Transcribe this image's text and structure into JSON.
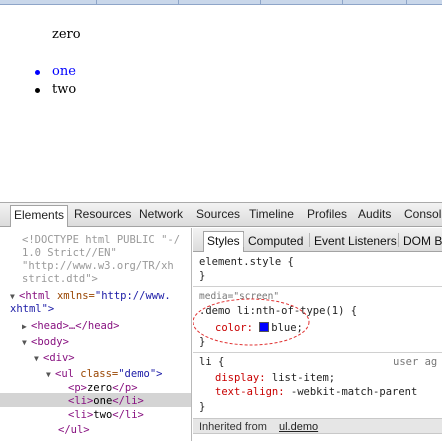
{
  "rendered_page": {
    "paragraph": "zero",
    "list_items": [
      "one",
      "two"
    ],
    "bullet_color": "#0000ff"
  },
  "devtools": {
    "tabs": [
      "Elements",
      "Resources",
      "Network",
      "Sources",
      "Timeline",
      "Profiles",
      "Audits",
      "Consol"
    ],
    "active_tab": "Elements",
    "dom": {
      "doctype_1": "<!DOCTYPE html PUBLIC \"-/",
      "doctype_2": "1.0 Strict//EN\"",
      "doctype_3": "\"http://www.w3.org/TR/xh",
      "doctype_4": "strict.dtd\">",
      "html_tag": "<html",
      "html_attr": "xmlns=",
      "html_val": "\"http://www.",
      "html_cont": "xhtml\">",
      "head": "<head>…</head>",
      "body": "<body>",
      "div": "<div>",
      "ul_open": "<ul",
      "ul_attr": "class=",
      "ul_val": "\"demo\">",
      "p_open": "<p>",
      "p_text": "zero",
      "p_close": "</p>",
      "li1_open": "<li>",
      "li1_text": "one",
      "li1_close": "</li>",
      "li2_open": "<li>",
      "li2_text": "two",
      "li2_close": "</li>",
      "ul_close": "</ul>"
    },
    "styles_tabs": [
      "Styles",
      "Computed",
      "Event Listeners",
      "DOM B"
    ],
    "styles": {
      "element_style": "element.style {",
      "close_brace": "}",
      "media": "media=\"screen\"",
      "rule_selector": ".demo li:nth-of-type(1) {",
      "rule_prop": "color:",
      "rule_value": "blue;",
      "rule_color": "#0000ff",
      "ua_selector": "li {",
      "ua_label": "user ag",
      "ua_prop1": "display:",
      "ua_val1": "list-item;",
      "ua_prop2": "text-align:",
      "ua_val2": "-webkit-match-parent",
      "inherited_label": "Inherited from",
      "inherited_link": "ul.demo"
    }
  }
}
